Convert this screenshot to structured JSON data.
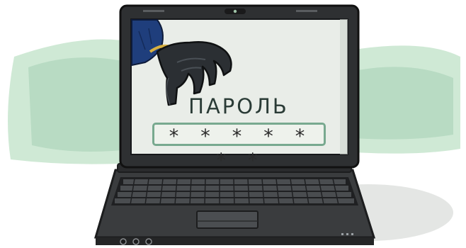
{
  "screen": {
    "password_label": "ПАРОЛЬ",
    "password_mask": "* * * * * * *"
  },
  "colors": {
    "screen_bg": "#e9ede8",
    "field_border": "#78a98f",
    "laptop_body": "#3a3c3e",
    "background_wash": "#7fbf93"
  },
  "icons": {
    "hand": "gloved-hand-icon",
    "webcam": "webcam-icon"
  }
}
